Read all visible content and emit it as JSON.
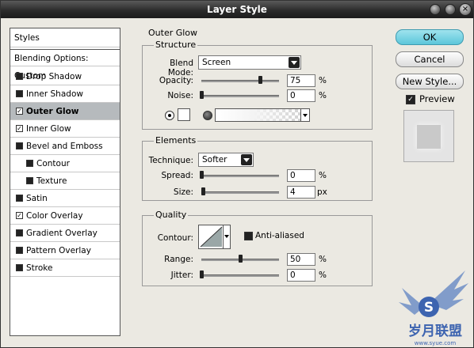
{
  "window": {
    "title": "Layer Style"
  },
  "styles_list": {
    "header": "Styles",
    "blending": "Blending Options: Custom",
    "items": [
      {
        "label": "Drop Shadow",
        "checked": false,
        "indent": false,
        "selected": false
      },
      {
        "label": "Inner Shadow",
        "checked": false,
        "indent": false,
        "selected": false
      },
      {
        "label": "Outer Glow",
        "checked": true,
        "indent": false,
        "selected": true
      },
      {
        "label": "Inner Glow",
        "checked": true,
        "indent": false,
        "selected": false
      },
      {
        "label": "Bevel and Emboss",
        "checked": false,
        "indent": false,
        "selected": false
      },
      {
        "label": "Contour",
        "checked": false,
        "indent": true,
        "selected": false
      },
      {
        "label": "Texture",
        "checked": false,
        "indent": true,
        "selected": false
      },
      {
        "label": "Satin",
        "checked": false,
        "indent": false,
        "selected": false
      },
      {
        "label": "Color Overlay",
        "checked": true,
        "indent": false,
        "selected": false
      },
      {
        "label": "Gradient Overlay",
        "checked": false,
        "indent": false,
        "selected": false
      },
      {
        "label": "Pattern Overlay",
        "checked": false,
        "indent": false,
        "selected": false
      },
      {
        "label": "Stroke",
        "checked": false,
        "indent": false,
        "selected": false
      }
    ]
  },
  "panel": {
    "title": "Outer Glow",
    "structure": {
      "title": "Structure",
      "blend_mode_label": "Blend Mode:",
      "blend_mode": "Screen",
      "opacity_label": "Opacity:",
      "opacity": "75",
      "opacity_level": 0.75,
      "noise_label": "Noise:",
      "noise": "0",
      "noise_level": 0,
      "percent": "%"
    },
    "elements": {
      "title": "Elements",
      "technique_label": "Technique:",
      "technique": "Softer",
      "spread_label": "Spread:",
      "spread": "0",
      "spread_level": 0,
      "size_label": "Size:",
      "size": "4",
      "size_level": 0.02,
      "percent": "%",
      "px": "px"
    },
    "quality": {
      "title": "Quality",
      "contour_label": "Contour:",
      "anti_aliased_label": "Anti-aliased",
      "range_label": "Range:",
      "range": "50",
      "range_level": 0.5,
      "jitter_label": "Jitter:",
      "jitter": "0",
      "jitter_level": 0,
      "percent": "%"
    }
  },
  "buttons": {
    "ok": "OK",
    "cancel": "Cancel",
    "new_style": "New Style...",
    "preview_label": "Preview"
  },
  "watermark": {
    "text": "S",
    "cn": "岁月联盟",
    "url": "www.syue.com"
  },
  "colors": {
    "selected_row": "#b6babd",
    "ok_button": "#5cc6da"
  }
}
